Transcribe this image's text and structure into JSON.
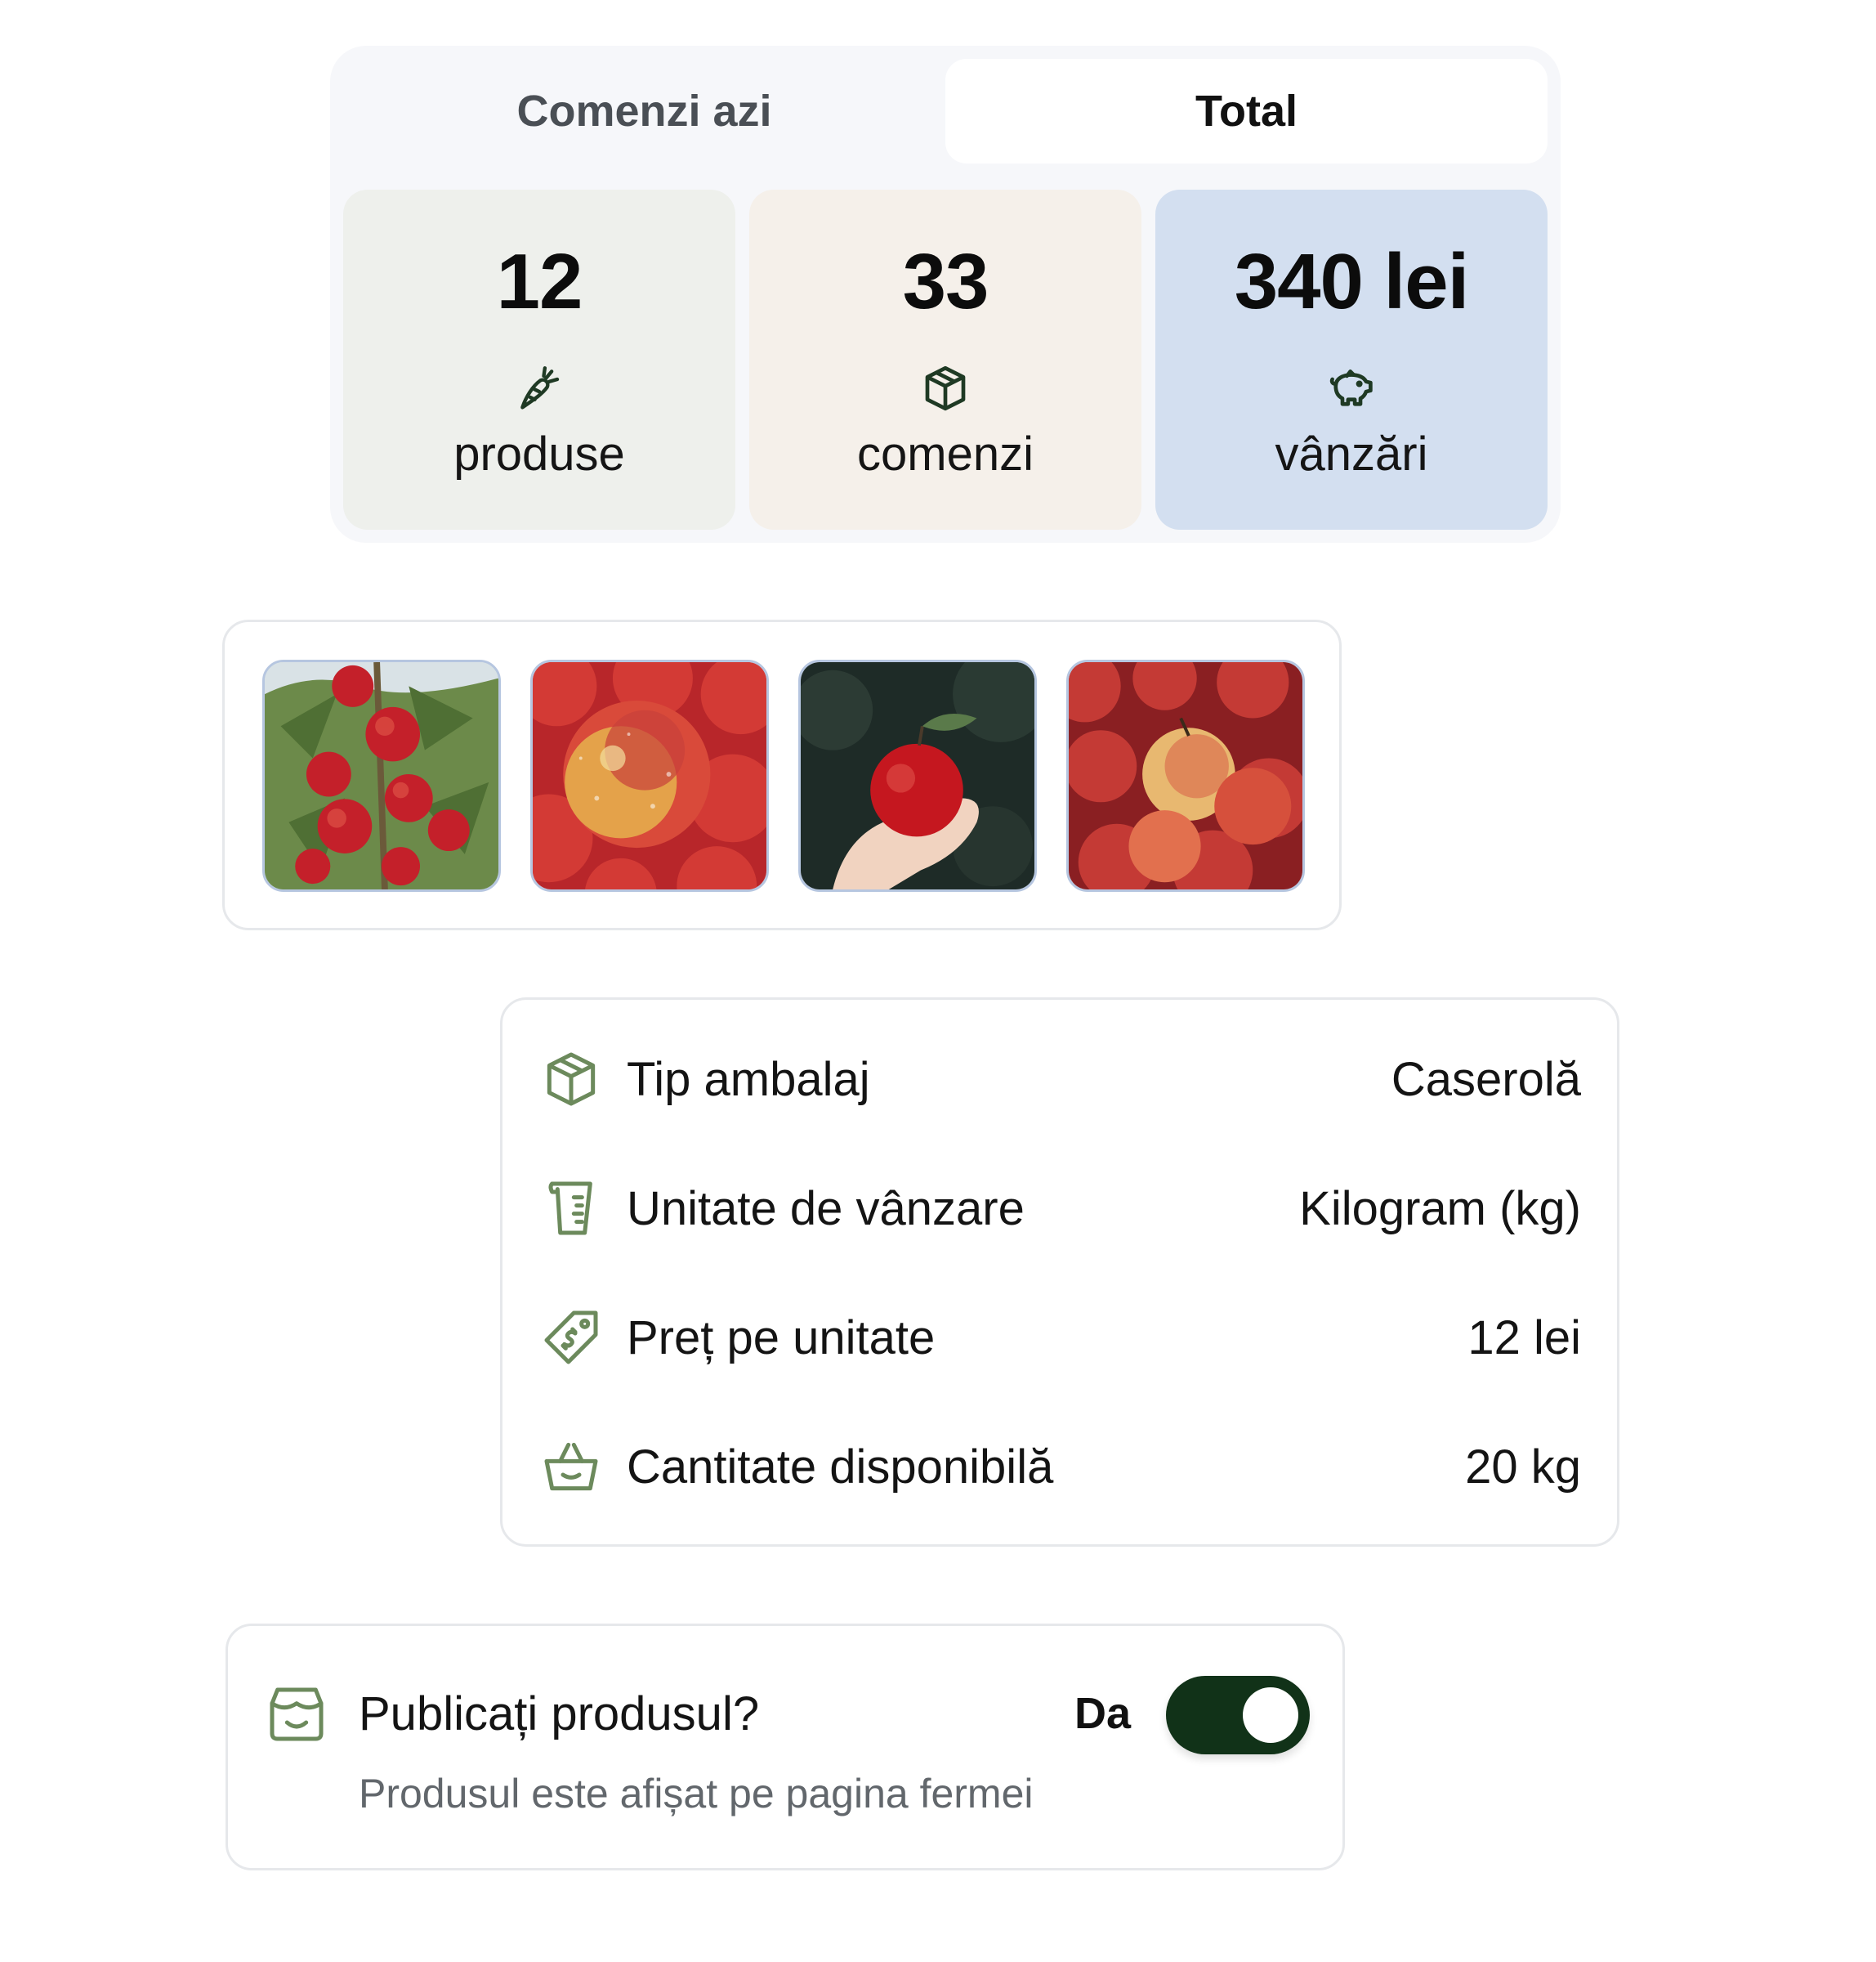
{
  "tabs": [
    {
      "label": "Comenzi azi",
      "active": false
    },
    {
      "label": "Total",
      "active": true
    }
  ],
  "stats": [
    {
      "value": "12",
      "label": "produse",
      "icon": "carrot-icon",
      "color": "#eef0ec"
    },
    {
      "value": "33",
      "label": "comenzi",
      "icon": "box-icon",
      "color": "#f5f0ea"
    },
    {
      "value": "340 lei",
      "label": "vânzări",
      "icon": "piggy-bank-icon",
      "color": "#d3dff0"
    }
  ],
  "gallery": {
    "images": [
      "apple-tree-photo",
      "wet-apples-photo",
      "hand-apple-photo",
      "apple-pile-photo"
    ]
  },
  "details": [
    {
      "label": "Tip ambalaj",
      "value": "Caserolă",
      "icon": "package-icon"
    },
    {
      "label": "Unitate de vânzare",
      "value": "Kilogram (kg)",
      "icon": "measuring-cup-icon"
    },
    {
      "label": "Preț pe unitate",
      "value": "12 lei",
      "icon": "price-tag-icon"
    },
    {
      "label": "Cantitate disponibilă",
      "value": "20 kg",
      "icon": "basket-icon"
    }
  ],
  "publish": {
    "title": "Publicați produsul?",
    "subtitle": "Produsul este afișat pe pagina fermei",
    "state_label": "Da",
    "enabled": true,
    "icon": "store-icon"
  },
  "colors": {
    "accent": "#113218",
    "icon_green": "#6c8a5c",
    "stat_icon": "#1f3a24"
  }
}
